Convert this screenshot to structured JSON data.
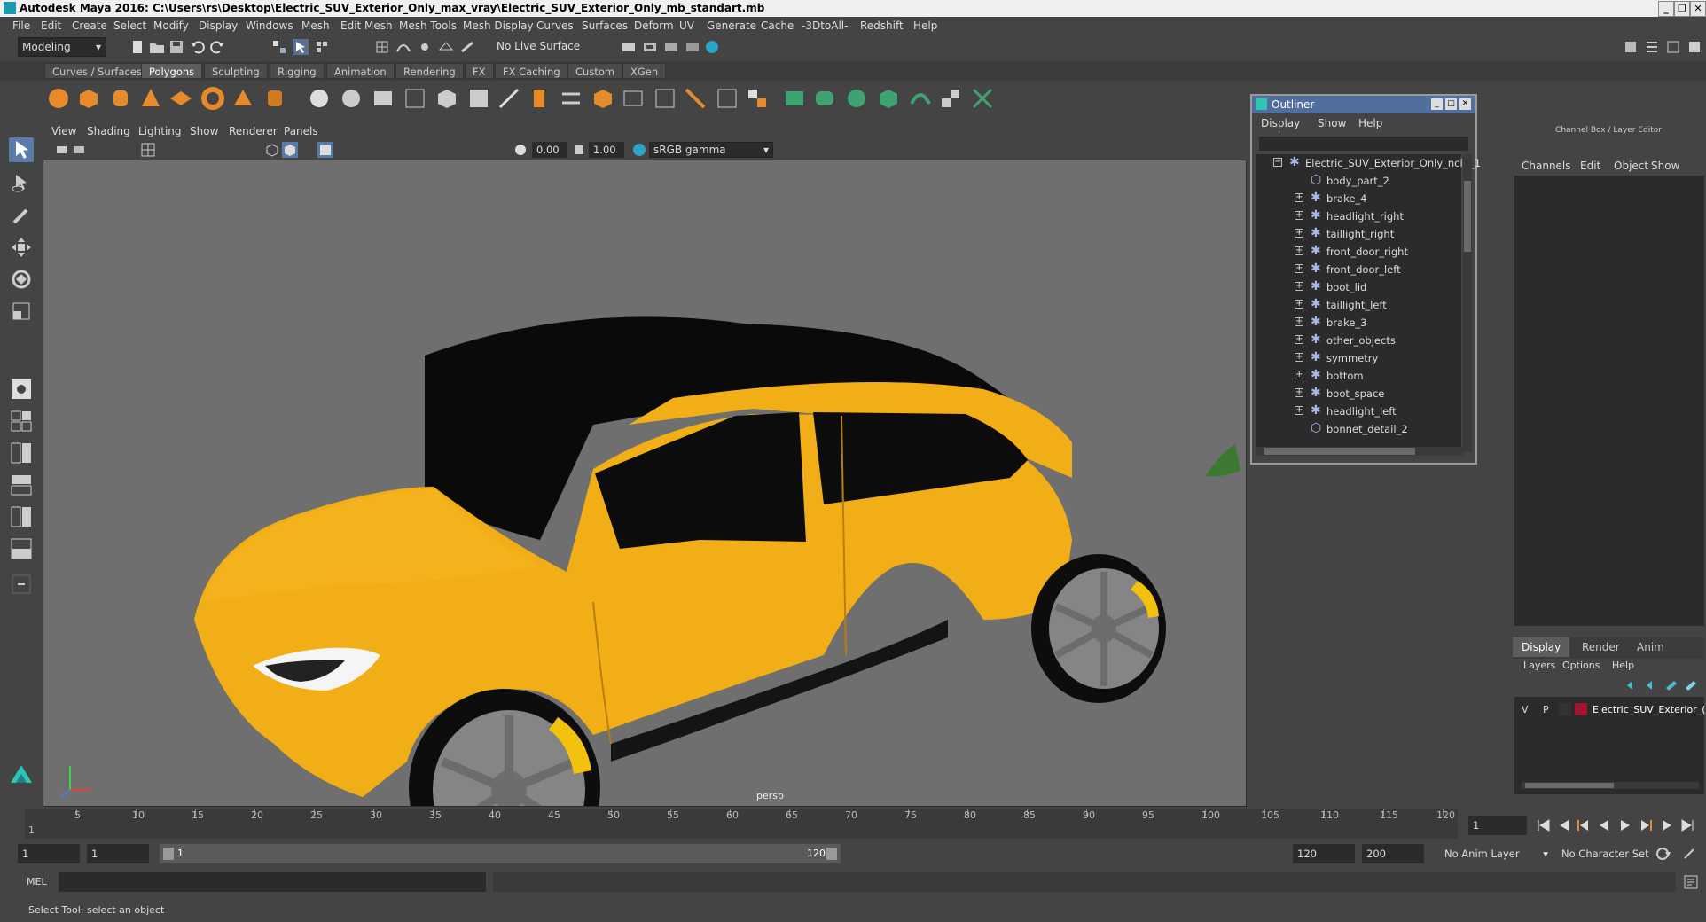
{
  "window": {
    "title": "Autodesk Maya 2016: C:\\Users\\rs\\Desktop\\Electric_SUV_Exterior_Only_max_vray\\Electric_SUV_Exterior_Only_mb_standart.mb",
    "minimize": "_",
    "maximize": "❐",
    "close": "✕"
  },
  "menubar": {
    "items": [
      "File",
      "Edit",
      "Create",
      "Select",
      "Modify",
      "Display",
      "Windows",
      "Mesh",
      "Edit Mesh",
      "Mesh Tools",
      "Mesh Display",
      "Curves",
      "Surfaces",
      "Deform",
      "UV",
      "Generate",
      "Cache",
      "-3DtoAll-",
      "Redshift",
      "Help"
    ]
  },
  "statusline": {
    "mode": "Modeling",
    "live_surface": "No Live Surface"
  },
  "shelf": {
    "tabs": [
      "Curves / Surfaces",
      "Polygons",
      "Sculpting",
      "Rigging",
      "Animation",
      "Rendering",
      "FX",
      "FX Caching",
      "Custom",
      "XGen"
    ],
    "active_tab": "Polygons"
  },
  "viewport": {
    "menu": [
      "View",
      "Shading",
      "Lighting",
      "Show",
      "Renderer",
      "Panels"
    ],
    "exposure": "0.00",
    "gamma": "1.00",
    "color_space": "sRGB gamma",
    "camera_label": "persp"
  },
  "outliner": {
    "title": "Outliner",
    "menu": [
      "Display",
      "Show",
      "Help"
    ],
    "root": "Electric_SUV_Exterior_Only_ncl1_1",
    "items": [
      {
        "label": "body_part_2",
        "expandable": false
      },
      {
        "label": "brake_4",
        "expandable": true
      },
      {
        "label": "headlight_right",
        "expandable": true
      },
      {
        "label": "taillight_right",
        "expandable": true
      },
      {
        "label": "front_door_right",
        "expandable": true
      },
      {
        "label": "front_door_left",
        "expandable": true
      },
      {
        "label": "boot_lid",
        "expandable": true
      },
      {
        "label": "taillight_left",
        "expandable": true
      },
      {
        "label": "brake_3",
        "expandable": true
      },
      {
        "label": "other_objects",
        "expandable": true
      },
      {
        "label": "symmetry",
        "expandable": true
      },
      {
        "label": "bottom",
        "expandable": true
      },
      {
        "label": "boot_space",
        "expandable": true
      },
      {
        "label": "headlight_left",
        "expandable": true
      },
      {
        "label": "bonnet_detail_2",
        "expandable": false
      }
    ]
  },
  "channelbox": {
    "header": "Channel Box / Layer Editor",
    "menu": [
      "Channels",
      "Edit",
      "Object",
      "Show"
    ],
    "layer_tabs": [
      "Display",
      "Render",
      "Anim"
    ],
    "layer_menu": [
      "Layers",
      "Options",
      "Help"
    ],
    "layer": {
      "v": "V",
      "p": "P",
      "name": "Electric_SUV_Exterior_(",
      "color": "#a0152a"
    }
  },
  "timeline": {
    "ticks": [
      "5",
      "10",
      "15",
      "20",
      "25",
      "30",
      "35",
      "40",
      "45",
      "50",
      "55",
      "60",
      "65",
      "70",
      "75",
      "80",
      "85",
      "90",
      "95",
      "100",
      "105",
      "110",
      "115",
      "120"
    ],
    "start_marker": "1",
    "current_frame": "1"
  },
  "range": {
    "start": "1",
    "playback_start": "1",
    "slider_start": "1",
    "slider_end": "120",
    "playback_end": "120",
    "end": "200",
    "anim_layer": "No Anim Layer",
    "character_set": "No Character Set"
  },
  "cmdline": {
    "label": "MEL"
  },
  "helpline": {
    "text": "Select Tool: select an object"
  },
  "colors": {
    "car_body": "#f2ae16",
    "glass": "#0a0a0a",
    "wheel": "#8a8a8a",
    "caliper": "#f2c10d",
    "outliner_title": "#516f9c"
  }
}
